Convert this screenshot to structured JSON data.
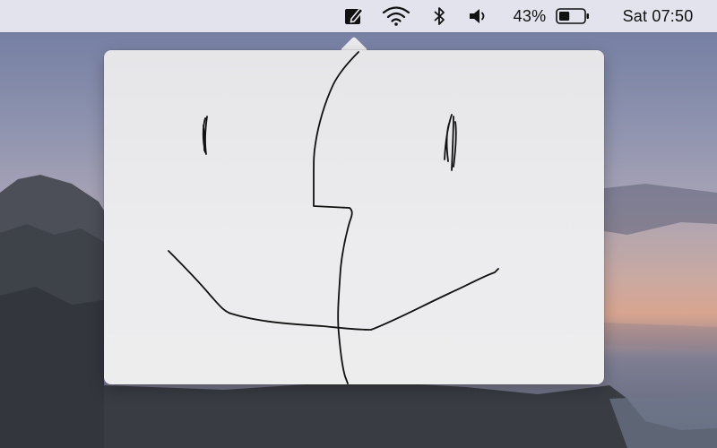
{
  "menubar": {
    "battery_percent_label": "43%",
    "clock": "Sat 07:50",
    "battery_level": 0.43,
    "icons": [
      "note-app-icon",
      "wifi-icon",
      "bluetooth-icon",
      "volume-icon",
      "battery-icon"
    ]
  },
  "colors": {
    "menubar_bg": "#ececf2",
    "popover_bg": "#ececee",
    "ink": "#111111"
  }
}
